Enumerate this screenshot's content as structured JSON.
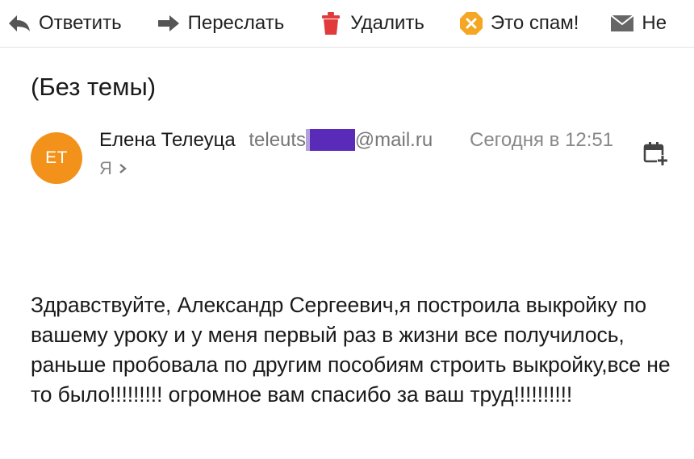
{
  "toolbar": {
    "reply_label": "Ответить",
    "forward_label": "Переслать",
    "delete_label": "Удалить",
    "spam_label": "Это спам!",
    "unread_label": "Не"
  },
  "message": {
    "subject": "(Без темы)",
    "avatar_initials": "ET",
    "avatar_color": "#f2921a",
    "sender_name": "Елена Телеуца",
    "sender_email_prefix": "teleuts",
    "sender_email_domain": "@mail.ru",
    "date": "Сегодня в 12:51",
    "recipient": "Я",
    "body": "Здравствуйте, Александр Сергеевич,я построила выкройку по вашему уроку и у меня первый раз в жизни все получилось, раньше пробовала по другим пособиям строить выкройку,все не то было!!!!!!!!! огромное вам спасибо за ваш труд!!!!!!!!!!"
  },
  "colors": {
    "delete_icon": "#e03a3a",
    "spam_icon": "#f5a623",
    "redaction": "#5a2ab8"
  }
}
